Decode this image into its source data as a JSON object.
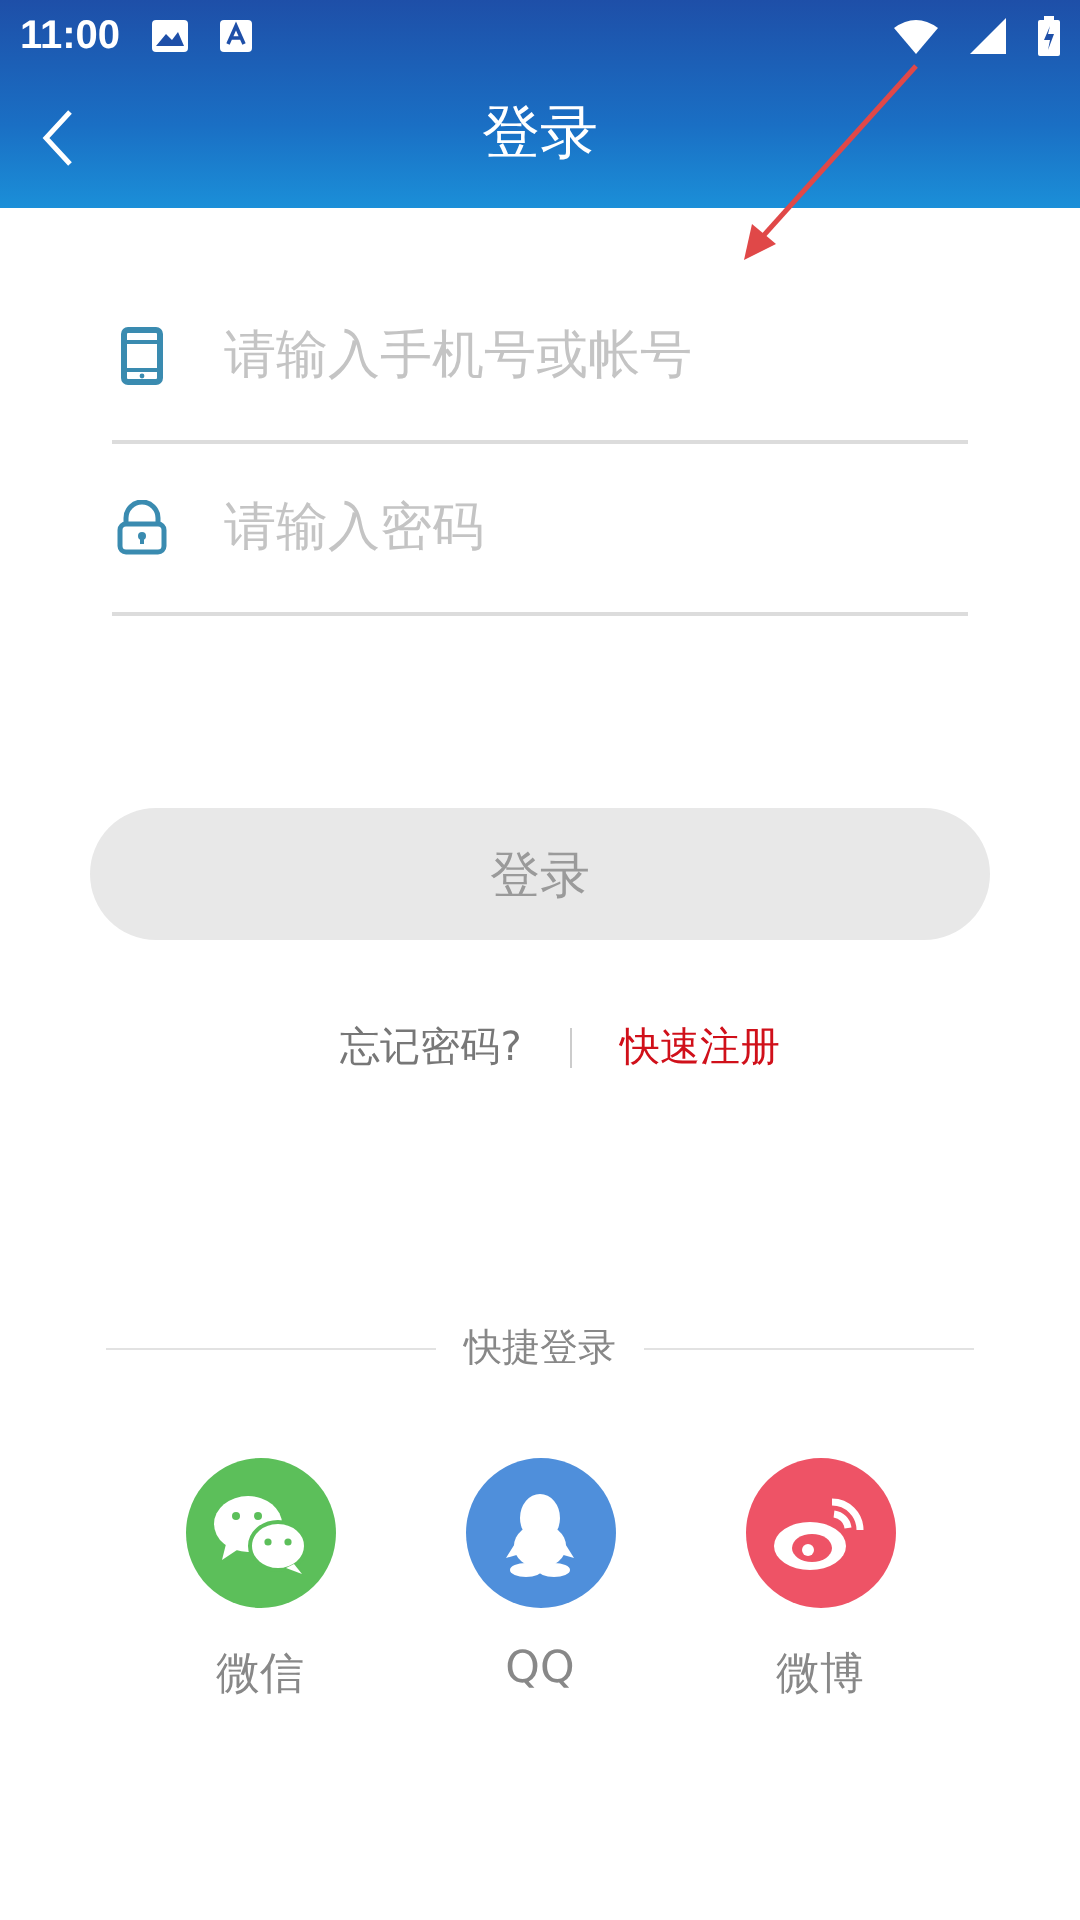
{
  "status_bar": {
    "time": "11:00"
  },
  "header": {
    "title": "登录"
  },
  "fields": [
    {
      "kind": "phone",
      "placeholder": "请输入手机号或帐号"
    },
    {
      "kind": "lock",
      "placeholder": "请输入密码"
    }
  ],
  "login_button": {
    "label": "登录",
    "disabled": true
  },
  "links": {
    "forgot": "忘记密码?",
    "register": "快速注册"
  },
  "quick_login": {
    "title": "快捷登录",
    "items": [
      {
        "kind": "wechat",
        "label": "微信",
        "color": "#5cbf5a"
      },
      {
        "kind": "qq",
        "label": "QQ",
        "color": "#4f8fdb"
      },
      {
        "kind": "weibo",
        "label": "微博",
        "color": "#ee5366"
      }
    ]
  }
}
